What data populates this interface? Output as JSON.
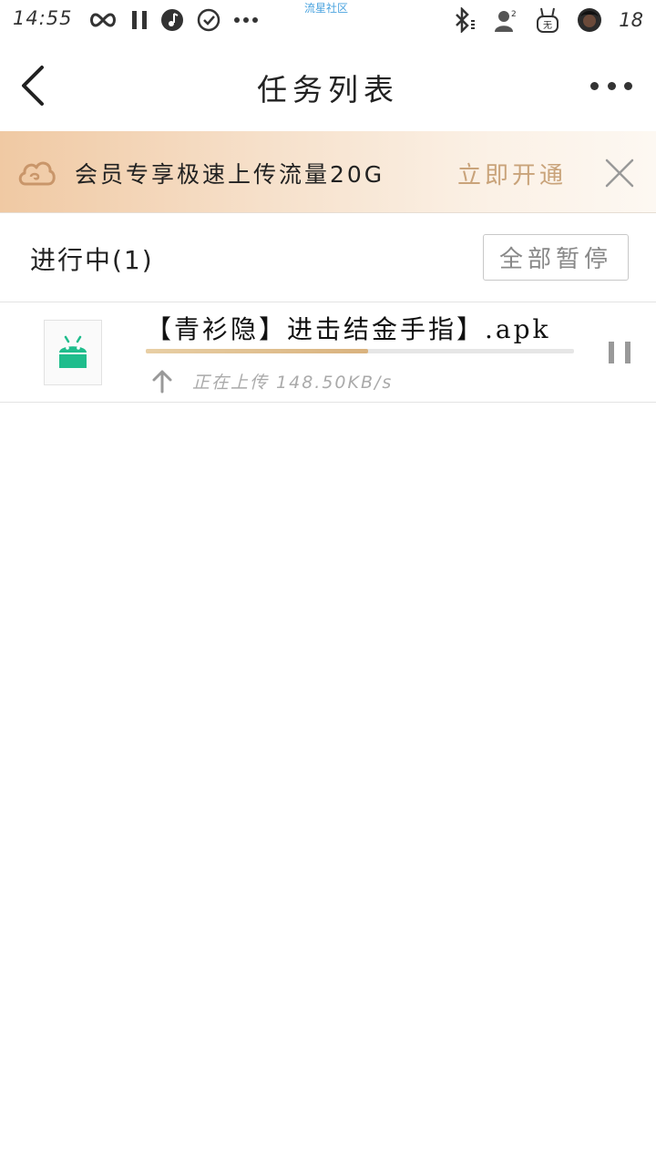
{
  "status_bar": {
    "time": "14:55",
    "carrier": "流星社区",
    "battery": "18",
    "left_icons": [
      "infinity-icon",
      "pause-icon",
      "music-note-icon",
      "check-circle-icon",
      "more-dots-icon"
    ],
    "right_icons": [
      "bluetooth-icon",
      "user-avatar-icon",
      "rabbit-icon",
      "profile-avatar-icon"
    ]
  },
  "header": {
    "title": "任务列表",
    "back_icon": "chevron-left-icon",
    "more_icon": "more-horizontal-icon"
  },
  "promo": {
    "text": "会员专享极速上传流量20G",
    "action": "立即开通",
    "icon": "cloud-icon",
    "close_icon": "close-icon"
  },
  "section": {
    "title": "进行中(1)",
    "pause_all_label": "全部暂停"
  },
  "tasks": [
    {
      "name": "【青衫隐】进击结金手指】.apk",
      "status": "正在上传 148.50KB/s",
      "progress": 0.52,
      "file_icon": "android-icon",
      "direction_icon": "arrow-up-icon",
      "action_icon": "pause-icon"
    }
  ],
  "colors": {
    "promo_gradient_start": "#f0c9a3",
    "promo_action": "#c9a37a",
    "progress_fill": "#d9b27e",
    "android_green": "#1fbd8c",
    "carrier_blue": "#4aa3df"
  }
}
